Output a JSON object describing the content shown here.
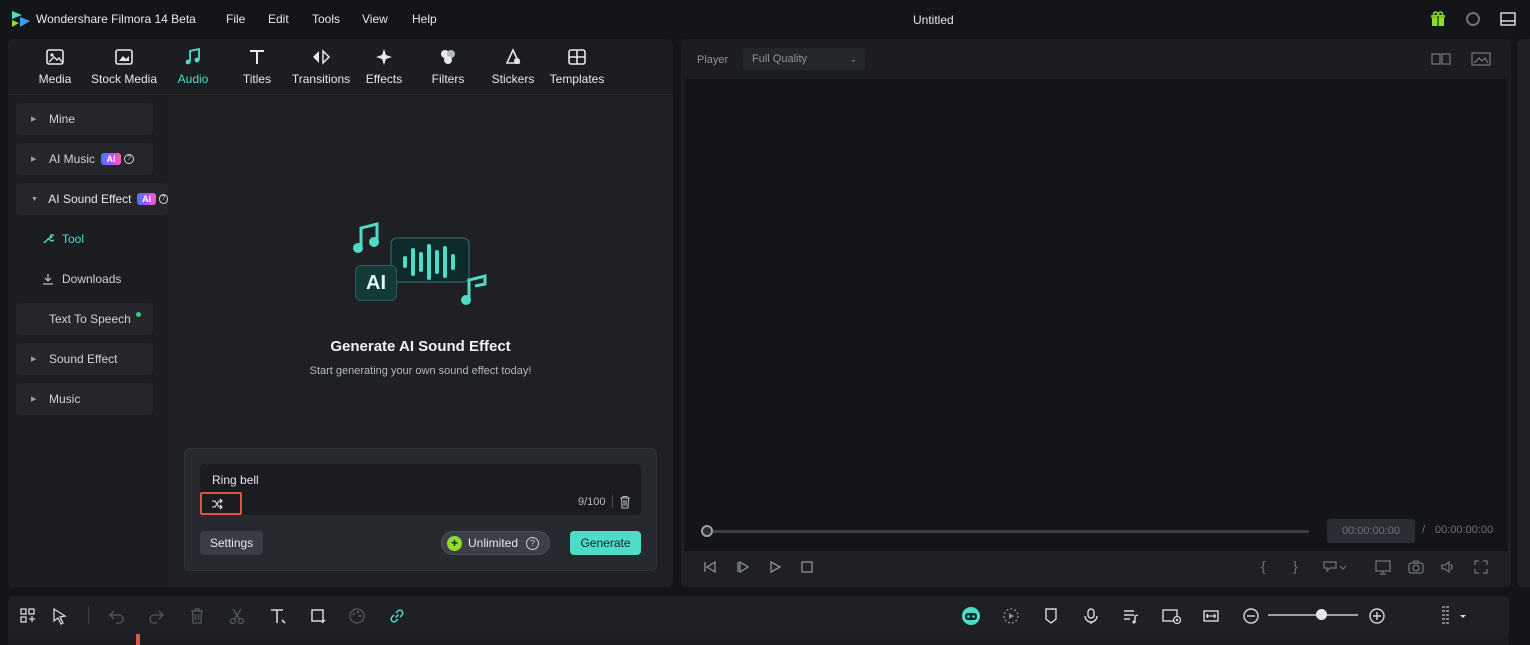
{
  "titlebar": {
    "app_title": "Wondershare Filmora 14 Beta",
    "menu": [
      "File",
      "Edit",
      "Tools",
      "View",
      "Help"
    ],
    "doc_title": "Untitled",
    "icons": [
      "gift-icon",
      "record-icon",
      "layout-icon"
    ]
  },
  "media_tabs": [
    {
      "label": "Media",
      "icon": "media-icon"
    },
    {
      "label": "Stock Media",
      "icon": "stock-media-icon"
    },
    {
      "label": "Audio",
      "icon": "music-note-icon",
      "active": true
    },
    {
      "label": "Titles",
      "icon": "titles-icon"
    },
    {
      "label": "Transitions",
      "icon": "transitions-icon"
    },
    {
      "label": "Effects",
      "icon": "effects-icon"
    },
    {
      "label": "Filters",
      "icon": "filters-icon"
    },
    {
      "label": "Stickers",
      "icon": "stickers-icon"
    },
    {
      "label": "Templates",
      "icon": "templates-icon"
    }
  ],
  "sidebar": {
    "items": [
      {
        "label": "Mine"
      },
      {
        "label": "AI Music",
        "badge": "AI"
      },
      {
        "label": "AI Sound Effect",
        "badge": "AI",
        "expanded": true
      },
      {
        "label": "Tool",
        "selected": true
      },
      {
        "label": "Downloads"
      },
      {
        "label": "Text To Speech"
      },
      {
        "label": "Sound Effect"
      },
      {
        "label": "Music"
      }
    ]
  },
  "hero": {
    "badge_text": "AI",
    "title": "Generate AI Sound Effect",
    "subtitle": "Start generating your own sound effect today!"
  },
  "generator": {
    "prompt": "Ring bell",
    "char_count": "9/100",
    "settings_label": "Settings",
    "unlimited_label": "Unlimited",
    "generate_label": "Generate"
  },
  "player": {
    "label": "Player",
    "quality": "Full Quality",
    "time_current": "00:00:00:00",
    "time_separator": "/",
    "time_total": "00:00:00:00",
    "progress": 0
  },
  "colors": {
    "accent": "#4fdbc6",
    "highlight_box": "#e0524c",
    "background": "#141518",
    "panel": "#1e2024"
  }
}
